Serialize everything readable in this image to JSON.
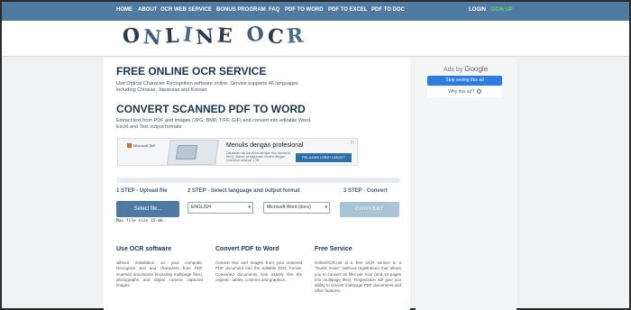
{
  "nav": {
    "items": [
      "HOME",
      "ABOUT",
      "OCR WEB SERVICE",
      "BONUS PROGRAM",
      "FAQ",
      "PDF TO WORD",
      "PDF TO EXCEL",
      "PDF TO DOC"
    ],
    "login": "LOGIN",
    "signup": "SIGN UP"
  },
  "logo": {
    "letters": [
      "O",
      "N",
      "L",
      "I",
      "N",
      "E",
      "O",
      "C",
      "R"
    ]
  },
  "service": {
    "title": "FREE ONLINE OCR SERVICE",
    "description": "Use Optical Character Recognition software online. Service supports 46 languages including Chinese, Japanese and Korean"
  },
  "convert": {
    "title": "CONVERT SCANNED PDF TO WORD",
    "description": "Extract text from PDF and images (JPG, BMP, TIFF, GIF) and convert into editable Word, Excel and Text output formats"
  },
  "ad_banner": {
    "brand": "Microsoft 365",
    "title": "Menulis dengan profesional",
    "text": "Dapatkan sisi lain Anda dengan fitur cerdas di Word. Alasan penggunaan konten dengan OneDrive sebesar 1 TB",
    "button": "PELAJARI LEBIH LANJUT"
  },
  "steps": {
    "step1": "1 STEP - Upload file",
    "step2": "2 STEP - Select language and output format",
    "step3": "3 STEP - Convert"
  },
  "form": {
    "select_file": "Select file...",
    "max_size": "Max file size 15 mb.",
    "language": "ENGLISH",
    "format": "Microsoft Word (docx)",
    "convert": "CONVERT"
  },
  "columns": [
    {
      "title": "Use OCR software",
      "text": "without installation on your computer. Recognize text and characters from PDF scanned documents (including multipage files), photographs and digital camera captured images."
    },
    {
      "title": "Convert PDF to Word",
      "text": "Convert text and Images from your scanned PDF document into the editable DOC format. Converted documents look exactly like the original - tables, columns and graphics."
    },
    {
      "title": "Free Service",
      "text": "OnlineOCR.net is a free OCR service in a \"Guest mode\" (without registration) that allows you to convert 15 files per hour (and 15 pages into multipage files). Registration will give you ability to convert multipage PDF documents and other features."
    }
  ],
  "side_ad": {
    "ads_by": "Ads by",
    "google": "Google",
    "stop": "Stop seeing this ad",
    "why": "Why this ad?",
    "info": "i"
  }
}
